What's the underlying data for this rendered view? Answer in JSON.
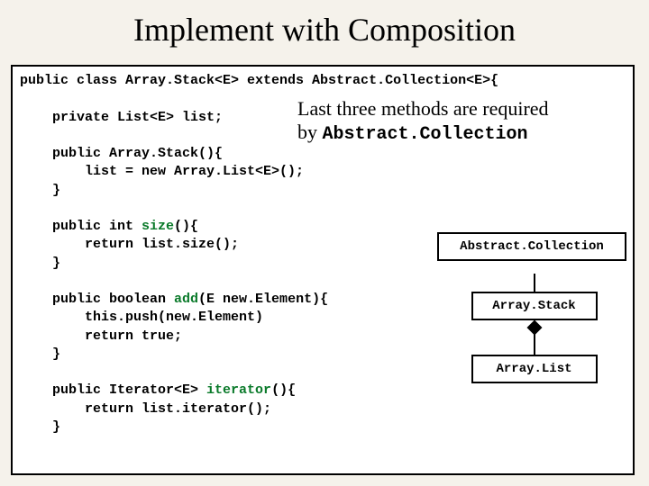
{
  "title": "Implement with Composition",
  "code": "public class Array.Stack<E> extends Abstract.Collection<E>{\n\n    private List<E> list;\n\n    public Array.Stack(){\n        list = new Array.List<E>();\n    }\n\n    public int size(){\n        return list.size();\n    }\n\n    public boolean add(E new.Element){\n        this.push(new.Element)\n        return true;\n    }\n\n    public Iterator<E> iterator(){\n        return list.iterator();\n    }",
  "callout": {
    "line1": "Last three methods are required",
    "line2_pre": "by ",
    "line2_mono": "Abstract.Collection"
  },
  "uml": {
    "top": "Abstract.Collection",
    "mid": "Array.Stack",
    "bot": "Array.List"
  },
  "keywords_green": [
    "size",
    "add",
    "iterator"
  ]
}
